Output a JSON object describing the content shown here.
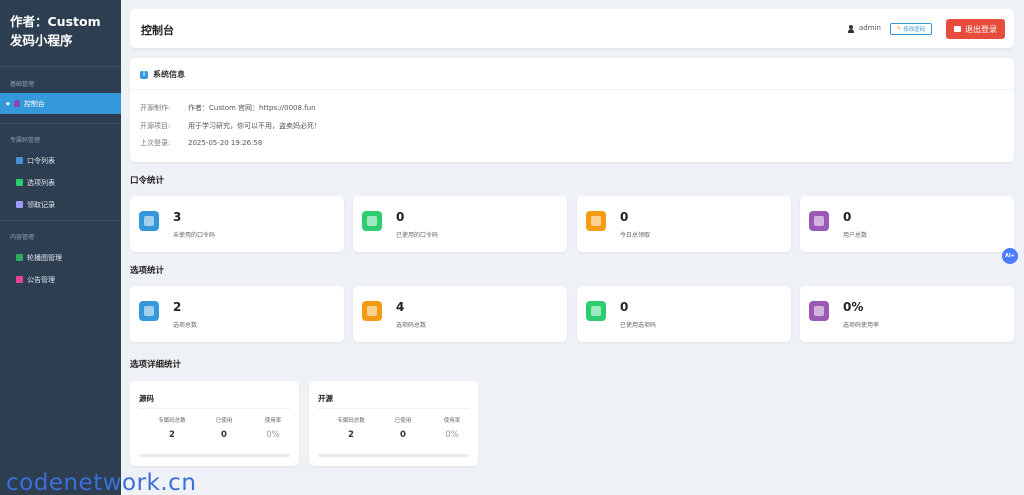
{
  "sidebar": {
    "brand_line1": "作者：Custom",
    "brand_line2": "发码小程序",
    "sections": [
      {
        "title": "基础管理",
        "items": [
          {
            "label": "控制台",
            "icon": "user-icon",
            "active": true
          }
        ]
      },
      {
        "title": "专属码管理",
        "items": [
          {
            "label": "口令列表",
            "icon": "list-icon"
          },
          {
            "label": "选项列表",
            "icon": "checkbox-icon"
          },
          {
            "label": "领取记录",
            "icon": "calendar-icon"
          }
        ]
      },
      {
        "title": "内容管理",
        "items": [
          {
            "label": "轮播图管理",
            "icon": "image-icon"
          },
          {
            "label": "公告管理",
            "icon": "megaphone-icon"
          }
        ]
      }
    ]
  },
  "header": {
    "title": "控制台",
    "username": "admin",
    "change_password": "修改密码",
    "logout": "退出登录"
  },
  "system_info": {
    "title": "系统信息",
    "rows": [
      {
        "key": "开源制作:",
        "value": "作者：Custom 官网：https://0008.fun"
      },
      {
        "key": "开源项目:",
        "value": "用于学习研究，你可以不用，盗卖妈必死！"
      },
      {
        "key": "上次登录:",
        "value": "2025-05-20 19:26:58"
      }
    ]
  },
  "code_stats": {
    "title": "口令统计",
    "cards": [
      {
        "value": "3",
        "label": "未使用的口令码",
        "color": "#3498db",
        "icon": "puzzle-icon"
      },
      {
        "value": "0",
        "label": "已使用的口令码",
        "color": "#2ecc71",
        "icon": "check-icon"
      },
      {
        "value": "0",
        "label": "今日总领取",
        "color": "#f39c12",
        "icon": "calendar-icon"
      },
      {
        "value": "0",
        "label": "用户总数",
        "color": "#9b59b6",
        "icon": "users-icon"
      }
    ]
  },
  "option_stats": {
    "title": "选项统计",
    "cards": [
      {
        "value": "2",
        "label": "选项总数",
        "color": "#3498db",
        "icon": "puzzle-icon"
      },
      {
        "value": "4",
        "label": "选项码总数",
        "color": "#f39c12",
        "icon": "1234-icon"
      },
      {
        "value": "0",
        "label": "已使用选项码",
        "color": "#2ecc71",
        "icon": "refresh-icon"
      },
      {
        "value": "0%",
        "label": "选项码使用率",
        "color": "#9b59b6",
        "icon": "bar-chart-icon"
      }
    ]
  },
  "detail_stats": {
    "title": "选项详细统计",
    "cards": [
      {
        "name": "源码",
        "headers": [
          "专属码总数",
          "已使用",
          "使用率"
        ],
        "values": [
          "2",
          "0",
          "0%"
        ],
        "usage": 0
      },
      {
        "name": "开源",
        "headers": [
          "专属码总数",
          "已使用",
          "使用率"
        ],
        "values": [
          "2",
          "0",
          "0%"
        ],
        "usage": 0
      }
    ]
  },
  "floating_button": "AI+",
  "watermark": "codenetwork.cn"
}
